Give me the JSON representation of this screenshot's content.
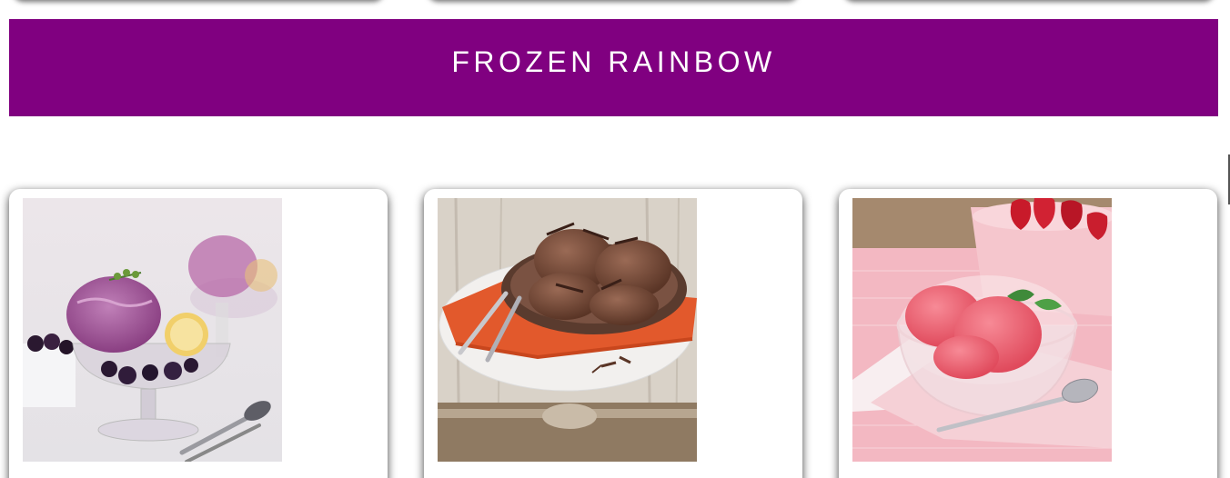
{
  "banner": {
    "title": "FROZEN RAINBOW",
    "background_color": "#800080"
  },
  "cards": [
    {
      "image_icon": "blueberry-ice-cream-photo"
    },
    {
      "image_icon": "chocolate-ice-cream-photo"
    },
    {
      "image_icon": "strawberry-sorbet-photo"
    }
  ]
}
